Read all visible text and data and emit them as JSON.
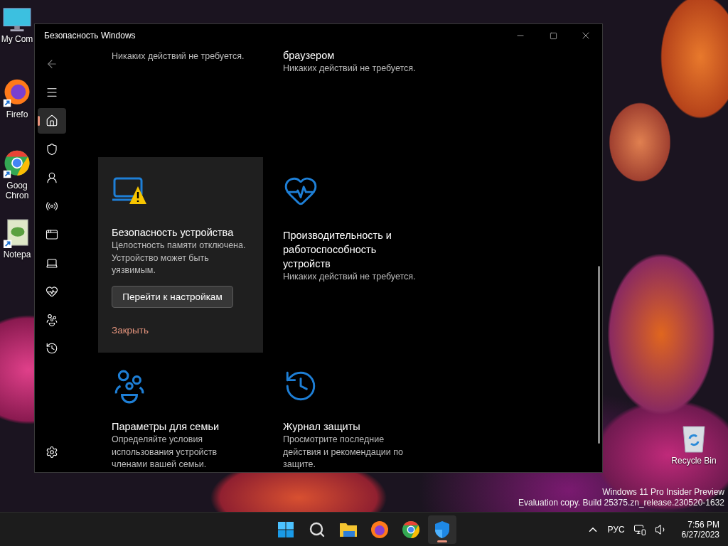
{
  "desktop": {
    "icons": [
      {
        "label": [
          "My Com"
        ]
      },
      {
        "label": [
          "Firefo"
        ]
      },
      {
        "label": [
          "Goog",
          "Chron"
        ]
      },
      {
        "label": [
          "Notepa"
        ]
      }
    ],
    "recycle_bin": {
      "label": "Recycle Bin"
    },
    "build_info": [
      "Windows 11 Pro Insider Preview",
      "Evaluation copy. Build 25375.zn_release.230520-1632"
    ]
  },
  "window": {
    "title": "Безопасность Windows",
    "nav": [
      {
        "selected": false
      },
      {
        "selected": false
      },
      {
        "selected": true
      },
      {
        "selected": false
      },
      {
        "selected": false
      },
      {
        "selected": false
      },
      {
        "selected": false
      },
      {
        "selected": false
      },
      {
        "selected": false
      },
      {
        "selected": false
      },
      {
        "selected": false
      }
    ],
    "cards": [
      {
        "description": "Никаких действий не требуется.",
        "highlighted": false
      },
      {
        "title": "браузером",
        "description": "Никаких действий не требуется.",
        "highlighted": false
      },
      {
        "title": "Безопасность устройства",
        "description": "Целостность памяти отключена. Устройство может быть уязвимым.",
        "button": "Перейти к настройкам",
        "link": "Закрыть",
        "highlighted": true
      },
      {
        "title": "Производительность и работоспособность устройств",
        "description": "Никаких действий не требуется.",
        "highlighted": false
      },
      {
        "title": "Параметры для семьи",
        "description": "Определяйте условия использования устройств членами вашей семьи.",
        "highlighted": false
      },
      {
        "title": "Журнал защиты",
        "description": "Просмотрите последние действия и рекомендации по защите.",
        "highlighted": false
      }
    ]
  },
  "taskbar": {
    "apps": [
      {
        "active": false
      },
      {
        "active": false
      },
      {
        "active": false
      },
      {
        "active": false
      },
      {
        "active": false
      },
      {
        "active": true
      }
    ],
    "tray": {
      "language": "РУС",
      "time": "7:56 PM",
      "date": "6/27/2023"
    }
  }
}
